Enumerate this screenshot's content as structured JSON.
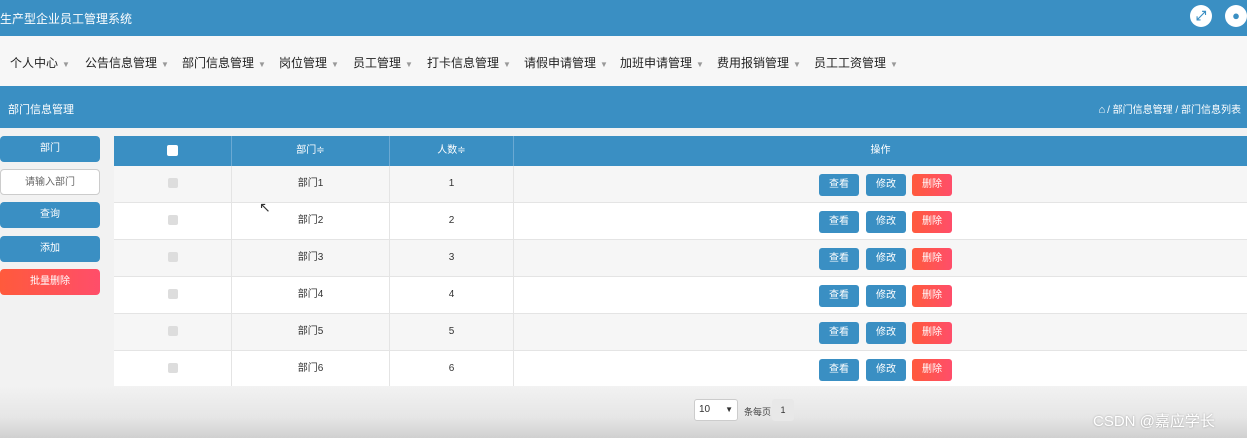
{
  "app": {
    "title": "生产型企业员工管理系统"
  },
  "topbar": {
    "expand_icon": "expand-icon",
    "user_icon": "user-icon"
  },
  "nav": {
    "items": [
      {
        "label": "个人中心"
      },
      {
        "label": "公告信息管理"
      },
      {
        "label": "部门信息管理"
      },
      {
        "label": "岗位管理"
      },
      {
        "label": "员工管理"
      },
      {
        "label": "打卡信息管理"
      },
      {
        "label": "请假申请管理"
      },
      {
        "label": "加班申请管理"
      },
      {
        "label": "费用报销管理"
      },
      {
        "label": "员工工资管理"
      }
    ]
  },
  "subheader": {
    "title": "部门信息管理",
    "breadcrumb": "/ 部门信息管理 / 部门信息列表"
  },
  "sidebar": {
    "field_label": "部门",
    "input_placeholder": "请输入部门",
    "query_label": "查询",
    "add_label": "添加",
    "batch_delete_label": "批量删除"
  },
  "table": {
    "headers": {
      "name": "部门≑",
      "count": "人数≑",
      "ops": "操作"
    },
    "rows": [
      {
        "name": "部门1",
        "count": "1"
      },
      {
        "name": "部门2",
        "count": "2"
      },
      {
        "name": "部门3",
        "count": "3"
      },
      {
        "name": "部门4",
        "count": "4"
      },
      {
        "name": "部门5",
        "count": "5"
      },
      {
        "name": "部门6",
        "count": "6"
      }
    ],
    "actions": {
      "view": "查看",
      "edit": "修改",
      "delete": "删除"
    }
  },
  "pagination": {
    "page_size": "10",
    "per_page_label": "条每页",
    "current_page": "1"
  },
  "watermark": "CSDN @嘉应学长",
  "colors": {
    "primary": "#3a8fc3",
    "danger": "#ff5a3c"
  }
}
